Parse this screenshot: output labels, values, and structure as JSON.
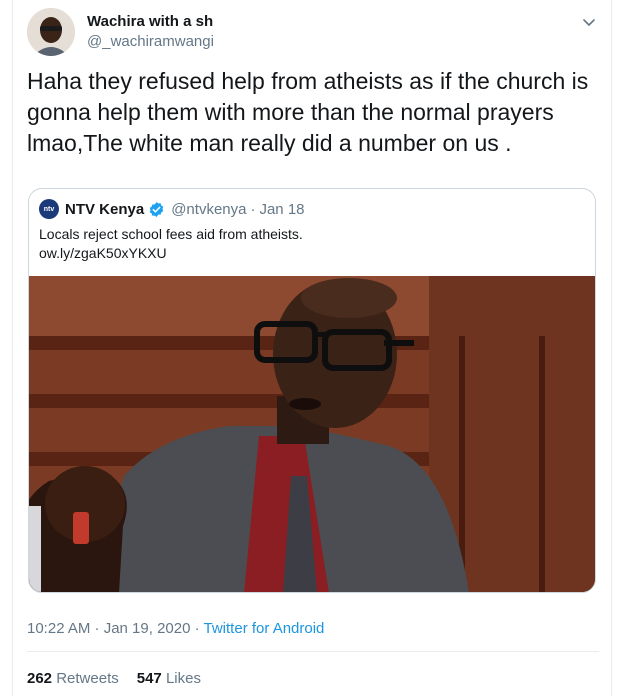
{
  "author": {
    "display_name": "Wachira with a sh",
    "handle": "@_wachiramwangi"
  },
  "tweet": {
    "text": "Haha they refused  help  from atheists as if the church is gonna  help them with more than the normal prayers lmao,The white man  really did a number  on us ."
  },
  "quoted_tweet": {
    "logo_text": "ntv",
    "name": "NTV Kenya",
    "handle": "@ntvkenya",
    "separator": "·",
    "date": "Jan 18",
    "text_line1": "Locals reject school fees aid from atheists.",
    "text_line2": "ow.ly/zgaK50xYKXU"
  },
  "meta": {
    "time_date": "10:22 AM · Jan 19, 2020 · ",
    "source": "Twitter for Android"
  },
  "stats": {
    "retweets_count": "262",
    "retweets_label": "Retweets",
    "likes_count": "547",
    "likes_label": "Likes"
  },
  "colors": {
    "link_blue": "#1b95e0",
    "muted_gray": "#657786",
    "verified_blue": "#1da1f2",
    "ntv_logo_navy": "#1b3a7a"
  },
  "icons": {
    "more": "chevron-down-icon",
    "verified": "verified-badge-icon"
  }
}
